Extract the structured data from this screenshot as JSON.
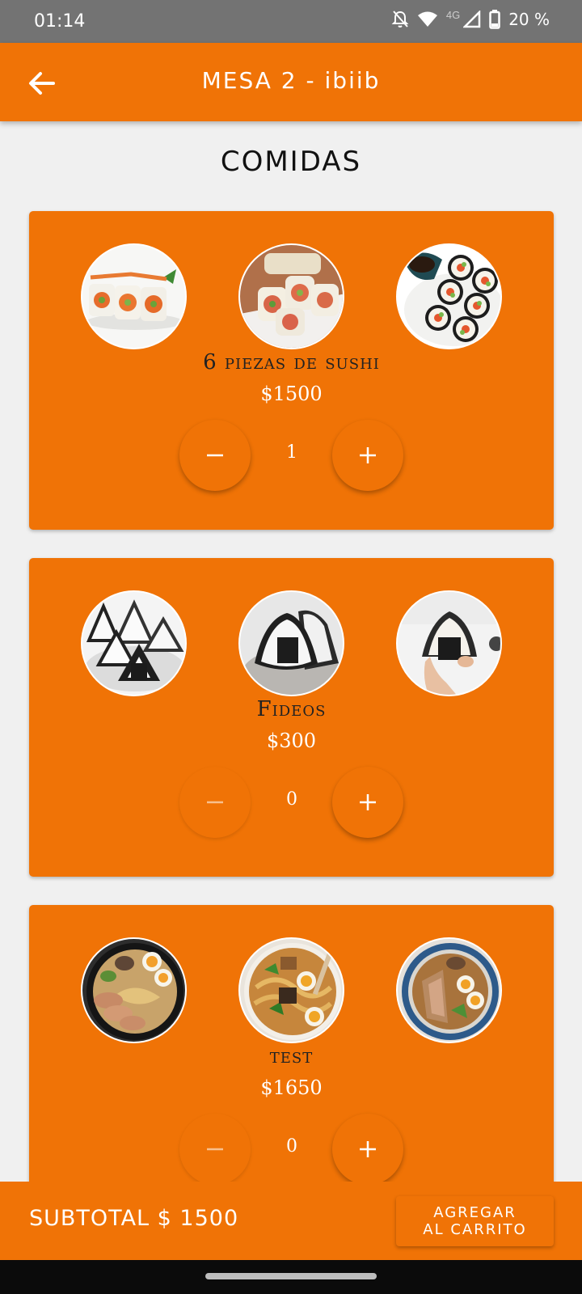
{
  "status_bar": {
    "time": "01:14",
    "network": "4G",
    "battery": "20 %"
  },
  "header": {
    "title": "MESA 2 - ibiib"
  },
  "section": {
    "title": "COMIDAS"
  },
  "items": [
    {
      "name": "6 piezas de sushi",
      "price": "$1500",
      "quantity": "1",
      "image_type": "sushi"
    },
    {
      "name": "Fideos",
      "price": "$300",
      "quantity": "0",
      "image_type": "onigiri"
    },
    {
      "name": "test",
      "price": "$1650",
      "quantity": "0",
      "image_type": "ramen"
    }
  ],
  "footer": {
    "subtotal": "SUBTOTAL $ 1500",
    "add_to_cart_line1": "AGREGAR",
    "add_to_cart_line2": "AL CARRITO"
  },
  "colors": {
    "primary": "#f07306",
    "background": "#f0f0f0",
    "status_bar": "#737373"
  }
}
